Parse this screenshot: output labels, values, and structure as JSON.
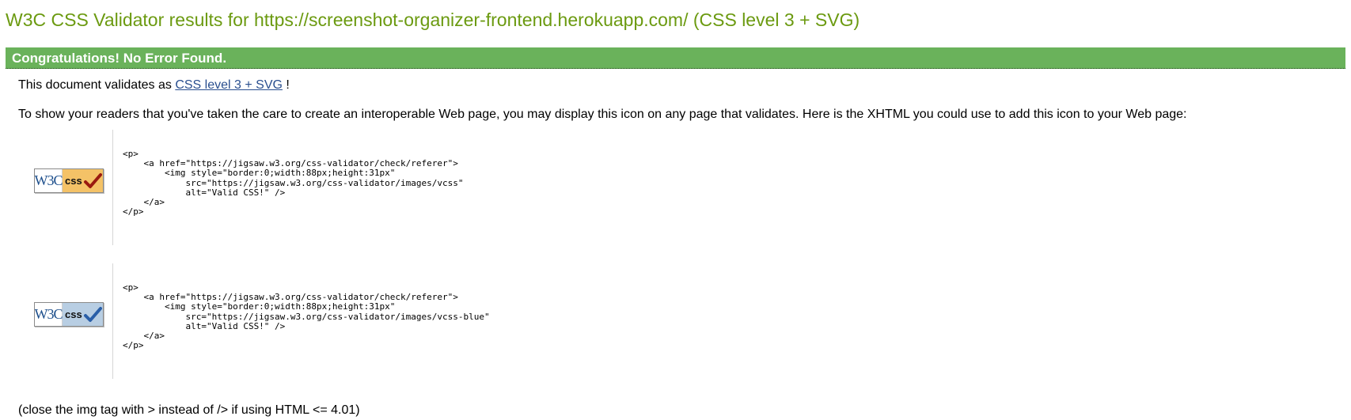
{
  "page": {
    "title": "W3C CSS Validator results for https://screenshot-organizer-frontend.herokuapp.com/ (CSS level 3 + SVG)"
  },
  "banner": {
    "text": "Congratulations! No Error Found.",
    "color": "#6ab25b"
  },
  "validation": {
    "prefix": "This document validates as ",
    "link_text": "CSS level 3 + SVG",
    "suffix": " !"
  },
  "info_text": "To show your readers that you've taken the care to create an interoperable Web page, you may display this icon on any page that validates. Here is the XHTML you could use to add this icon to your Web page:",
  "badges": [
    {
      "w3c_label": "W3C",
      "css_label": "css",
      "variant": "gold",
      "check_color": "#9a1a10",
      "code": "<p>\n    <a href=\"https://jigsaw.w3.org/css-validator/check/referer\">\n        <img style=\"border:0;width:88px;height:31px\"\n            src=\"https://jigsaw.w3.org/css-validator/images/vcss\"\n            alt=\"Valid CSS!\" />\n    </a>\n</p>"
    },
    {
      "w3c_label": "W3C",
      "css_label": "css",
      "variant": "blue",
      "check_color": "#2a5fa8",
      "code": "<p>\n    <a href=\"https://jigsaw.w3.org/css-validator/check/referer\">\n        <img style=\"border:0;width:88px;height:31px\"\n            src=\"https://jigsaw.w3.org/css-validator/images/vcss-blue\"\n            alt=\"Valid CSS!\" />\n    </a>\n</p>"
    }
  ],
  "footer_note": "(close the img tag with > instead of /> if using HTML <= 4.01)"
}
